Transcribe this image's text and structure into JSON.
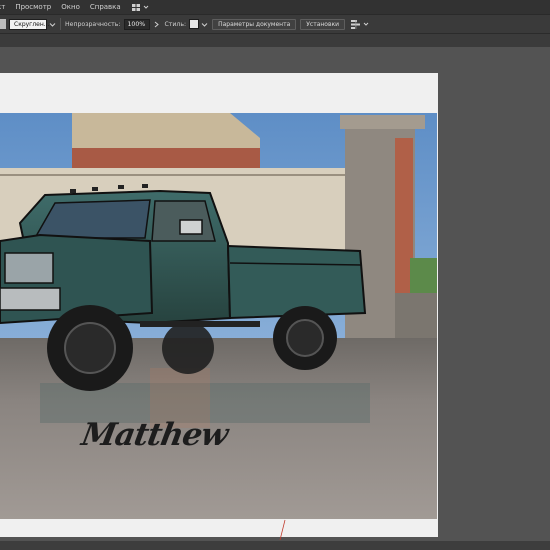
{
  "menubar": {
    "items": [
      "кт",
      "Просмотр",
      "Окно",
      "Справка"
    ]
  },
  "controlbar": {
    "brush": "Скруглен...",
    "opacity_label": "Непрозрачность:",
    "opacity_value": "100%",
    "style_label": "Стиль:",
    "doc_settings_button": "Параметры документа",
    "preferences_button": "Установки"
  },
  "canvas": {
    "signature_text": "Matthew"
  },
  "colors": {
    "workspace": "#535353",
    "menubar": "#323232",
    "controlbar": "#3a3a3a",
    "artboard": "#f0f0f0"
  }
}
